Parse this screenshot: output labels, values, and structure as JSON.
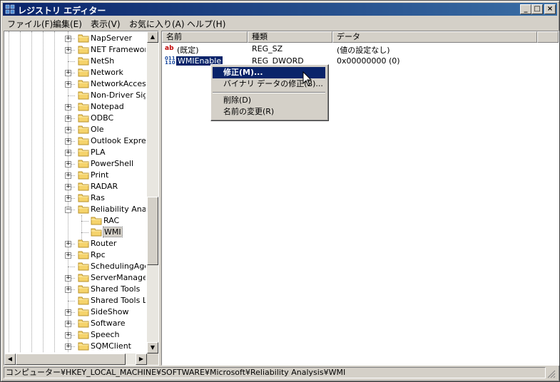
{
  "window": {
    "title": "レジストリ エディター",
    "minimize": "_",
    "maximize": "□",
    "close": "×"
  },
  "menu": [
    "ファイル(F)",
    "編集(E)",
    "表示(V)",
    "お気に入り(A)",
    "ヘルプ(H)"
  ],
  "tree": {
    "items": [
      {
        "label": "NapServer",
        "expandable": true
      },
      {
        "label": "NET Framework",
        "expandable": true
      },
      {
        "label": "NetSh",
        "expandable": false
      },
      {
        "label": "Network",
        "expandable": true
      },
      {
        "label": "NetworkAccessProtection",
        "expandable": true
      },
      {
        "label": "Non-Driver Signing",
        "expandable": false
      },
      {
        "label": "Notepad",
        "expandable": true
      },
      {
        "label": "ODBC",
        "expandable": true
      },
      {
        "label": "Ole",
        "expandable": true
      },
      {
        "label": "Outlook Express",
        "expandable": true
      },
      {
        "label": "PLA",
        "expandable": true
      },
      {
        "label": "PowerShell",
        "expandable": true
      },
      {
        "label": "Print",
        "expandable": true
      },
      {
        "label": "RADAR",
        "expandable": true
      },
      {
        "label": "Ras",
        "expandable": true
      },
      {
        "label": "Reliability Analysis",
        "expandable": true,
        "expanded": true
      },
      {
        "label": "RAC",
        "child": true
      },
      {
        "label": "WMI",
        "child": true,
        "selected": true
      },
      {
        "label": "Router",
        "expandable": true
      },
      {
        "label": "Rpc",
        "expandable": true
      },
      {
        "label": "SchedulingAgent",
        "expandable": false
      },
      {
        "label": "ServerManager",
        "expandable": true
      },
      {
        "label": "Shared Tools",
        "expandable": true
      },
      {
        "label": "Shared Tools Location",
        "expandable": false
      },
      {
        "label": "SideShow",
        "expandable": true
      },
      {
        "label": "Software",
        "expandable": true
      },
      {
        "label": "Speech",
        "expandable": true
      },
      {
        "label": "SQMClient",
        "expandable": true
      }
    ]
  },
  "list": {
    "columns": [
      "名前",
      "種類",
      "データ"
    ],
    "rows": [
      {
        "icon": "string-value-icon",
        "name": "(既定)",
        "type": "REG_SZ",
        "data": "(値の設定なし)"
      },
      {
        "icon": "binary-value-icon",
        "name": "WMIEnable",
        "type": "REG_DWORD",
        "data": "0x00000000 (0)"
      }
    ]
  },
  "context_menu": {
    "items": [
      "修正(M)...",
      "バイナリ データの修正(B)...",
      "削除(D)",
      "名前の変更(R)"
    ]
  },
  "status": "コンピューター¥HKEY_LOCAL_MACHINE¥SOFTWARE¥Microsoft¥Reliability Analysis¥WMI"
}
